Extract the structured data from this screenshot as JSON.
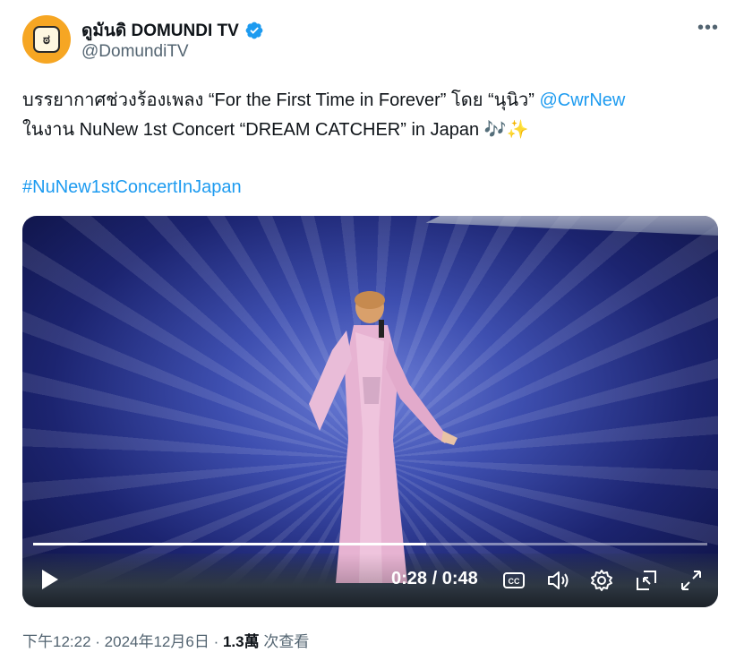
{
  "account": {
    "display_name": "ดูมันดิ DOMUNDI TV",
    "handle": "@DomundiTV",
    "avatar_letter": "ಠ"
  },
  "tweet": {
    "line1_text": "บรรยากาศช่วงร้องเพลง “For the First Time in Forever” โดย “นุนิว” ",
    "line1_mention": "@CwrNew",
    "line2_text": "ในงาน NuNew 1st Concert “DREAM CATCHER” in Japan ",
    "line2_emoji": "🎶✨",
    "hashtag": "#NuNew1stConcertInJapan"
  },
  "video": {
    "time_display": "0:28 / 0:48",
    "current_time": "0:28",
    "duration": "0:48",
    "progress_fraction": 0.583
  },
  "footer": {
    "time": "下午12:22",
    "separator1": " · ",
    "date": "2024年12月6日",
    "separator2": " · ",
    "views_count": "1.3萬",
    "views_label": " 次查看"
  },
  "colors": {
    "link": "#1d9bf0",
    "verified": "#1d9bf0",
    "secondary_text": "#536471",
    "avatar_bg": "#f6a623"
  }
}
